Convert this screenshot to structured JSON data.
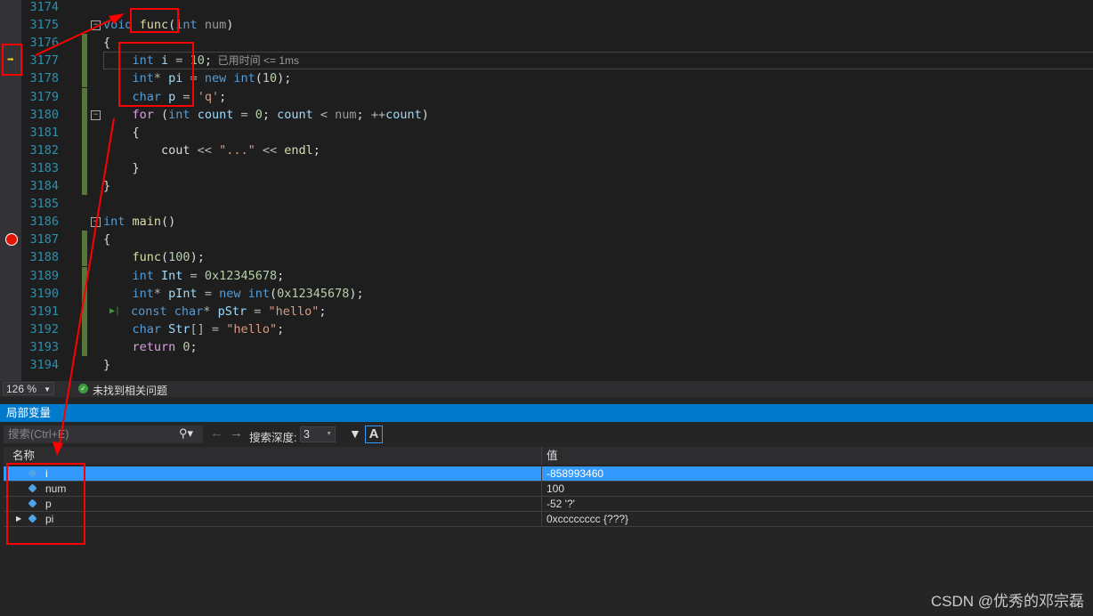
{
  "editor": {
    "lines": [
      {
        "n": "3174",
        "t": []
      },
      {
        "n": "3175",
        "t": [
          [
            "void ",
            "kw"
          ],
          [
            "func",
            "fn"
          ],
          [
            "(",
            "plain"
          ],
          [
            "int ",
            "kw"
          ],
          [
            "num",
            "param"
          ],
          [
            ")",
            "plain"
          ]
        ],
        "fold": true
      },
      {
        "n": "3176",
        "t": [
          [
            "{",
            "plain"
          ]
        ]
      },
      {
        "n": "3177",
        "t": [
          [
            "    int ",
            "kw"
          ],
          [
            "i",
            "var"
          ],
          [
            " = ",
            "op"
          ],
          [
            "10",
            "num"
          ],
          [
            ";",
            "plain"
          ]
        ],
        "current": true,
        "hint": "  已用时间 <= 1ms"
      },
      {
        "n": "3178",
        "t": [
          [
            "    int",
            "kw"
          ],
          [
            "* ",
            "op"
          ],
          [
            "pi",
            "var"
          ],
          [
            " = ",
            "op"
          ],
          [
            "new ",
            "kw"
          ],
          [
            "int",
            "kw"
          ],
          [
            "(",
            "plain"
          ],
          [
            "10",
            "num"
          ],
          [
            ");",
            "plain"
          ]
        ]
      },
      {
        "n": "3179",
        "t": [
          [
            "    char ",
            "kw"
          ],
          [
            "p",
            "var"
          ],
          [
            " = ",
            "op"
          ],
          [
            "'q'",
            "str"
          ],
          [
            ";",
            "plain"
          ]
        ]
      },
      {
        "n": "3180",
        "t": [
          [
            "    for ",
            "ctl"
          ],
          [
            "(",
            "plain"
          ],
          [
            "int ",
            "kw"
          ],
          [
            "count",
            "var"
          ],
          [
            " = ",
            "op"
          ],
          [
            "0",
            "num"
          ],
          [
            "; ",
            "plain"
          ],
          [
            "count",
            "var"
          ],
          [
            " < ",
            "op"
          ],
          [
            "num",
            "param"
          ],
          [
            "; ",
            "plain"
          ],
          [
            "++",
            "op"
          ],
          [
            "count",
            "var"
          ],
          [
            ")",
            "plain"
          ]
        ],
        "fold": true
      },
      {
        "n": "3181",
        "t": [
          [
            "    {",
            "plain"
          ]
        ]
      },
      {
        "n": "3182",
        "t": [
          [
            "        cout",
            "plain"
          ],
          [
            " << ",
            "op"
          ],
          [
            "\"...\"",
            "str"
          ],
          [
            " << ",
            "op"
          ],
          [
            "endl",
            "fn"
          ],
          [
            ";",
            "plain"
          ]
        ]
      },
      {
        "n": "3183",
        "t": [
          [
            "    }",
            "plain"
          ]
        ]
      },
      {
        "n": "3184",
        "t": [
          [
            "}",
            "plain"
          ]
        ]
      },
      {
        "n": "3185",
        "t": []
      },
      {
        "n": "3186",
        "t": [
          [
            "int ",
            "kw"
          ],
          [
            "main",
            "fn"
          ],
          [
            "()",
            "plain"
          ]
        ],
        "fold": true
      },
      {
        "n": "3187",
        "t": [
          [
            "{",
            "plain"
          ]
        ],
        "breakpoint": true
      },
      {
        "n": "3188",
        "t": [
          [
            "    func",
            "fn"
          ],
          [
            "(",
            "plain"
          ],
          [
            "100",
            "num"
          ],
          [
            ");",
            "plain"
          ]
        ]
      },
      {
        "n": "3189",
        "t": [
          [
            "    int ",
            "kw"
          ],
          [
            "Int",
            "var"
          ],
          [
            " = ",
            "op"
          ],
          [
            "0x12345678",
            "num"
          ],
          [
            ";",
            "plain"
          ]
        ]
      },
      {
        "n": "3190",
        "t": [
          [
            "    int",
            "kw"
          ],
          [
            "* ",
            "op"
          ],
          [
            "pInt",
            "var"
          ],
          [
            " = ",
            "op"
          ],
          [
            "new ",
            "kw"
          ],
          [
            "int",
            "kw"
          ],
          [
            "(",
            "plain"
          ],
          [
            "0x12345678",
            "num"
          ],
          [
            ");",
            "plain"
          ]
        ]
      },
      {
        "n": "3191",
        "t": [
          [
            "    const ",
            "kw"
          ],
          [
            "char",
            "kw"
          ],
          [
            "* ",
            "op"
          ],
          [
            "pStr",
            "var"
          ],
          [
            " = ",
            "op"
          ],
          [
            "\"hello\"",
            "str"
          ],
          [
            ";",
            "plain"
          ]
        ],
        "runto": true
      },
      {
        "n": "3192",
        "t": [
          [
            "    char ",
            "kw"
          ],
          [
            "Str",
            "var"
          ],
          [
            "[] = ",
            "op"
          ],
          [
            "\"hello\"",
            "str"
          ],
          [
            ";",
            "plain"
          ]
        ]
      },
      {
        "n": "3193",
        "t": [
          [
            "    return ",
            "ctl"
          ],
          [
            "0",
            "num"
          ],
          [
            ";",
            "plain"
          ]
        ]
      },
      {
        "n": "3194",
        "t": [
          [
            "}",
            "plain"
          ]
        ]
      }
    ]
  },
  "status": {
    "zoom": "126 %",
    "issues": "未找到相关问题"
  },
  "panel": {
    "title": "局部变量",
    "search_placeholder": "搜索(Ctrl+E)",
    "depth_label": "搜索深度:",
    "depth_value": "3",
    "columns": {
      "name": "名称",
      "value": "值"
    },
    "rows": [
      {
        "name": "i",
        "value": "-858993460",
        "selected": true
      },
      {
        "name": "num",
        "value": "100"
      },
      {
        "name": "p",
        "value": "-52 '?'"
      },
      {
        "name": "pi",
        "value": "0xcccccccc {???}",
        "expandable": true
      }
    ]
  },
  "watermark": "CSDN @优秀的邓宗磊",
  "colors": {
    "accent": "#007acc",
    "selection": "#3399ff",
    "annotation": "#ff0000"
  }
}
